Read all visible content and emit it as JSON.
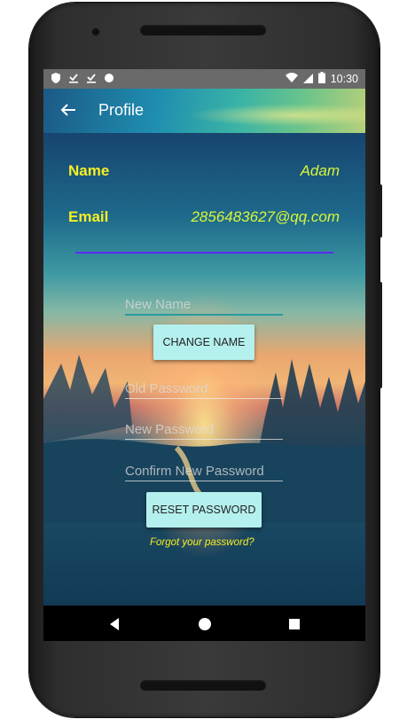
{
  "status_bar": {
    "time": "10:30",
    "icons": [
      "shield-icon",
      "download-done-icon",
      "download-done-icon",
      "circle-icon",
      "wifi-icon",
      "signal-icon",
      "battery-icon"
    ]
  },
  "app_bar": {
    "title": "Profile",
    "back_icon": "arrow-back-icon"
  },
  "profile": {
    "name_label": "Name",
    "name_value": "Adam",
    "email_label": "Email",
    "email_value": "2856483627@qq.com"
  },
  "change_name_form": {
    "new_name_placeholder": "New Name",
    "new_name_value": "",
    "button_label": "CHANGE NAME"
  },
  "reset_password_form": {
    "old_password_placeholder": "Old Password",
    "new_password_placeholder": "New Password",
    "confirm_password_placeholder": "Confirm New Password",
    "button_label": "RESET PASSWORD",
    "forgot_link": "Forgot your password?"
  },
  "nav_bar": {
    "buttons": [
      "back-triangle-icon",
      "home-circle-icon",
      "recents-square-icon"
    ]
  },
  "colors": {
    "label_yellow": "#f7ef22",
    "value_yellow": "#d9f53a",
    "divider_purple": "#5a2cf0",
    "button_bg": "#b4f0ee"
  }
}
